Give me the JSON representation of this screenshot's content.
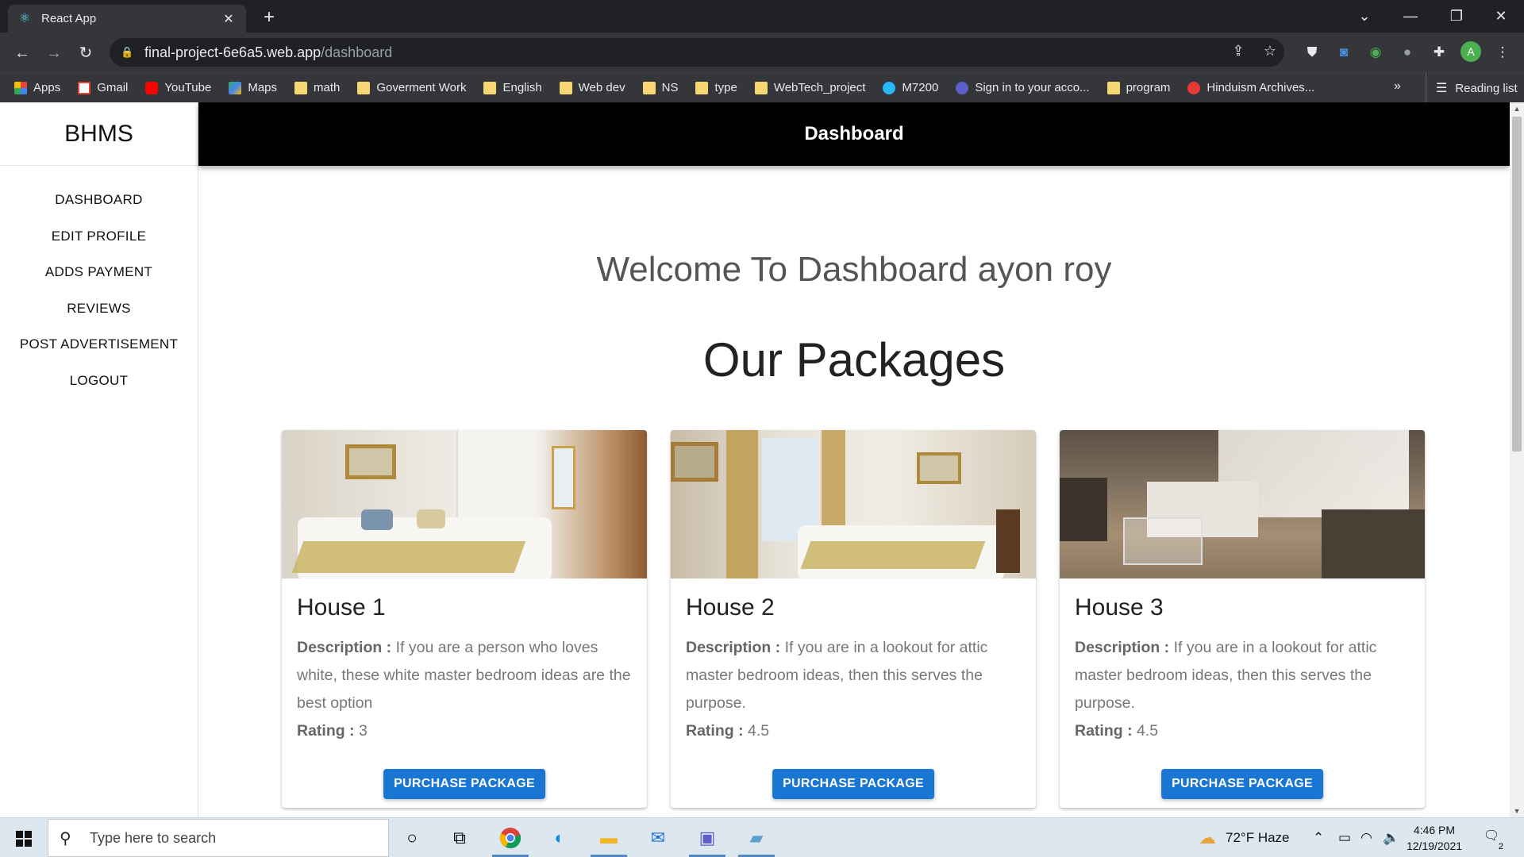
{
  "browser": {
    "tab_title": "React App",
    "tab_close": "✕",
    "new_tab": "+",
    "url_host": "final-project-6e6a5.web.app",
    "url_path": "/dashboard",
    "profile_initial": "A",
    "bookmarks": [
      {
        "label": "Apps",
        "kind": "apps"
      },
      {
        "label": "Gmail",
        "kind": "gmail"
      },
      {
        "label": "YouTube",
        "kind": "youtube"
      },
      {
        "label": "Maps",
        "kind": "maps"
      },
      {
        "label": "math",
        "kind": "folder"
      },
      {
        "label": "Goverment Work",
        "kind": "folder"
      },
      {
        "label": "English",
        "kind": "folder"
      },
      {
        "label": "Web dev",
        "kind": "folder"
      },
      {
        "label": "NS",
        "kind": "folder"
      },
      {
        "label": "type",
        "kind": "folder"
      },
      {
        "label": "WebTech_project",
        "kind": "folder"
      },
      {
        "label": "M7200",
        "kind": "site"
      },
      {
        "label": "Sign in to your acco...",
        "kind": "teams"
      },
      {
        "label": "program",
        "kind": "folder"
      },
      {
        "label": "Hinduism Archives...",
        "kind": "site-red"
      }
    ],
    "bookmarks_more": "»",
    "reading_list": "Reading list"
  },
  "sidebar": {
    "brand": "BHMS",
    "items": [
      {
        "label": "DASHBOARD"
      },
      {
        "label": "EDIT PROFILE"
      },
      {
        "label": "ADDS PAYMENT"
      },
      {
        "label": "REVIEWS"
      },
      {
        "label": "POST ADVERTISEMENT"
      },
      {
        "label": "LOGOUT"
      }
    ]
  },
  "header": {
    "title": "Dashboard"
  },
  "main": {
    "welcome": "Welcome To Dashboard ayon roy",
    "packages_title": "Our Packages",
    "cards": [
      {
        "name": "House 1",
        "desc_label": "Description :",
        "desc": "If you are a person who loves white, these white master bedroom ideas are the best option",
        "rating_label": "Rating :",
        "rating": "3",
        "button": "PURCHASE PACKAGE"
      },
      {
        "name": "House 2",
        "desc_label": "Description :",
        "desc": "If you are in a lookout for attic master bedroom ideas, then this serves the purpose.",
        "rating_label": "Rating :",
        "rating": "4.5",
        "button": "PURCHASE PACKAGE"
      },
      {
        "name": "House 3",
        "desc_label": "Description :",
        "desc": "If you are in a lookout for attic master bedroom ideas, then this serves the purpose.",
        "rating_label": "Rating :",
        "rating": "4.5",
        "button": "PURCHASE PACKAGE"
      }
    ]
  },
  "taskbar": {
    "search_placeholder": "Type here to search",
    "weather": "72°F  Haze",
    "time": "4:46 PM",
    "date": "12/19/2021",
    "notification_count": "2"
  },
  "colors": {
    "accent": "#1976d2",
    "appbar": "#000000",
    "chrome_dark": "#202124",
    "chrome_toolbar": "#35363a"
  }
}
